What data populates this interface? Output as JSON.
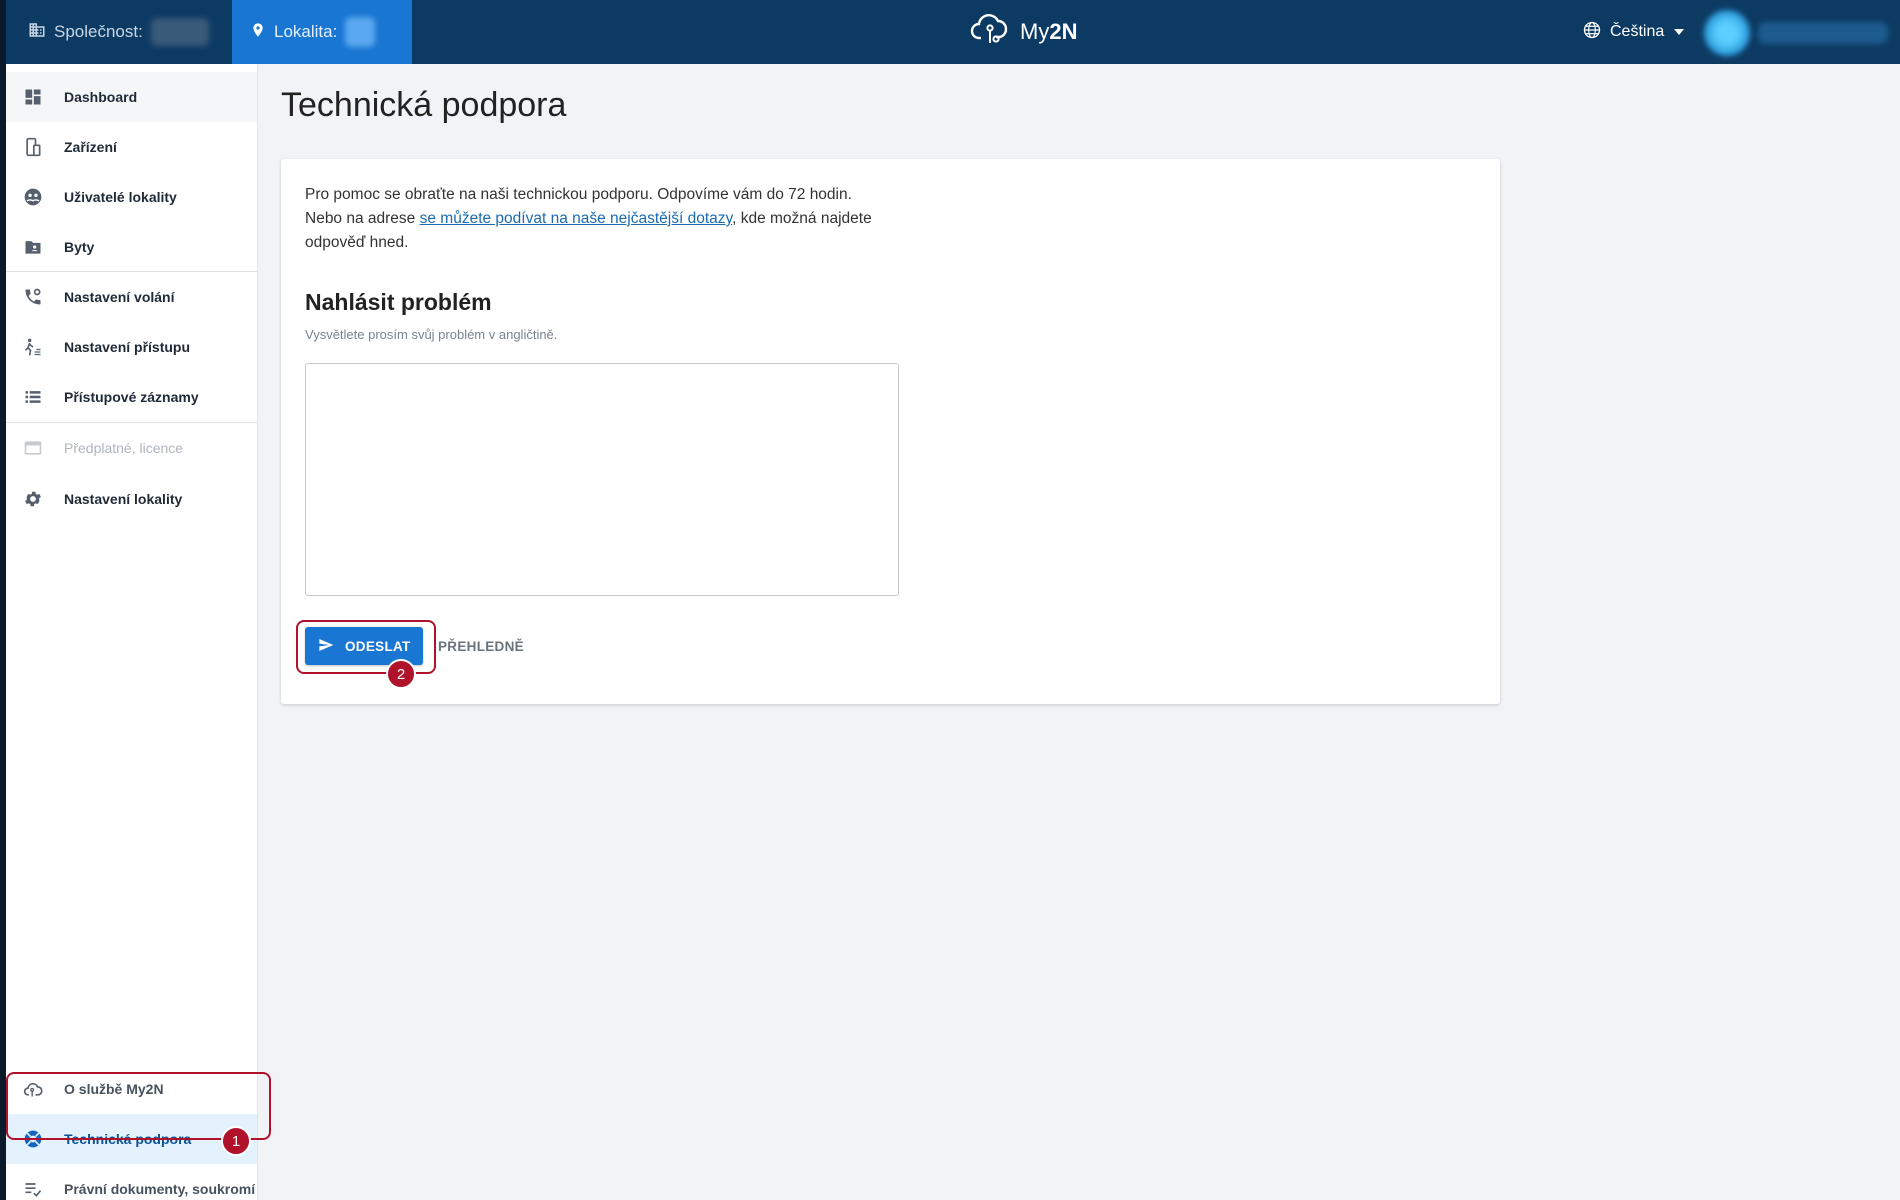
{
  "topbar": {
    "company_label": "Společnost:",
    "location_label": "Lokalita:",
    "logo_text_my": "My",
    "logo_text_2n": "2N",
    "language": "Čeština"
  },
  "sidebar": {
    "items": [
      {
        "label": "Dashboard",
        "icon": "dashboard-icon"
      },
      {
        "label": "Zařízení",
        "icon": "device-icon"
      },
      {
        "label": "Uživatelé lokality",
        "icon": "users-icon"
      },
      {
        "label": "Byty",
        "icon": "apartments-icon"
      },
      {
        "label": "Nastavení volání",
        "icon": "call-settings-icon"
      },
      {
        "label": "Nastavení přístupu",
        "icon": "access-settings-icon"
      },
      {
        "label": "Přístupové záznamy",
        "icon": "access-log-icon"
      },
      {
        "label": "Předplatné, licence",
        "icon": "card-icon"
      },
      {
        "label": "Nastavení lokality",
        "icon": "gear-icon"
      },
      {
        "label": "O službě My2N",
        "icon": "cloud-icon"
      },
      {
        "label": "Technická podpora",
        "icon": "support-icon"
      },
      {
        "label": "Právní dokumenty, soukromí",
        "icon": "legal-icon"
      }
    ]
  },
  "main": {
    "title": "Technická podpora",
    "intro_line1": "Pro pomoc se obraťte na naši technickou podporu. Odpovíme vám do 72 hodin.",
    "intro_line2_prefix": "Nebo na adrese ",
    "intro_link": "se můžete podívat na naše nejčastější dotazy",
    "intro_line2_suffix": ", kde možná najdete odpověď hned.",
    "section_title": "Nahlásit problém",
    "hint": "Vysvětlete prosím svůj problém v angličtině.",
    "textarea_value": "",
    "send_label": "ODESLAT",
    "clear_label": "PŘEHLEDNĚ"
  },
  "annotations": {
    "mark1": "1",
    "mark2": "2"
  },
  "colors": {
    "topbar": "#0d3a63",
    "location_active": "#1976d2",
    "accent": "#1976d2",
    "annotation": "#b0122c"
  }
}
